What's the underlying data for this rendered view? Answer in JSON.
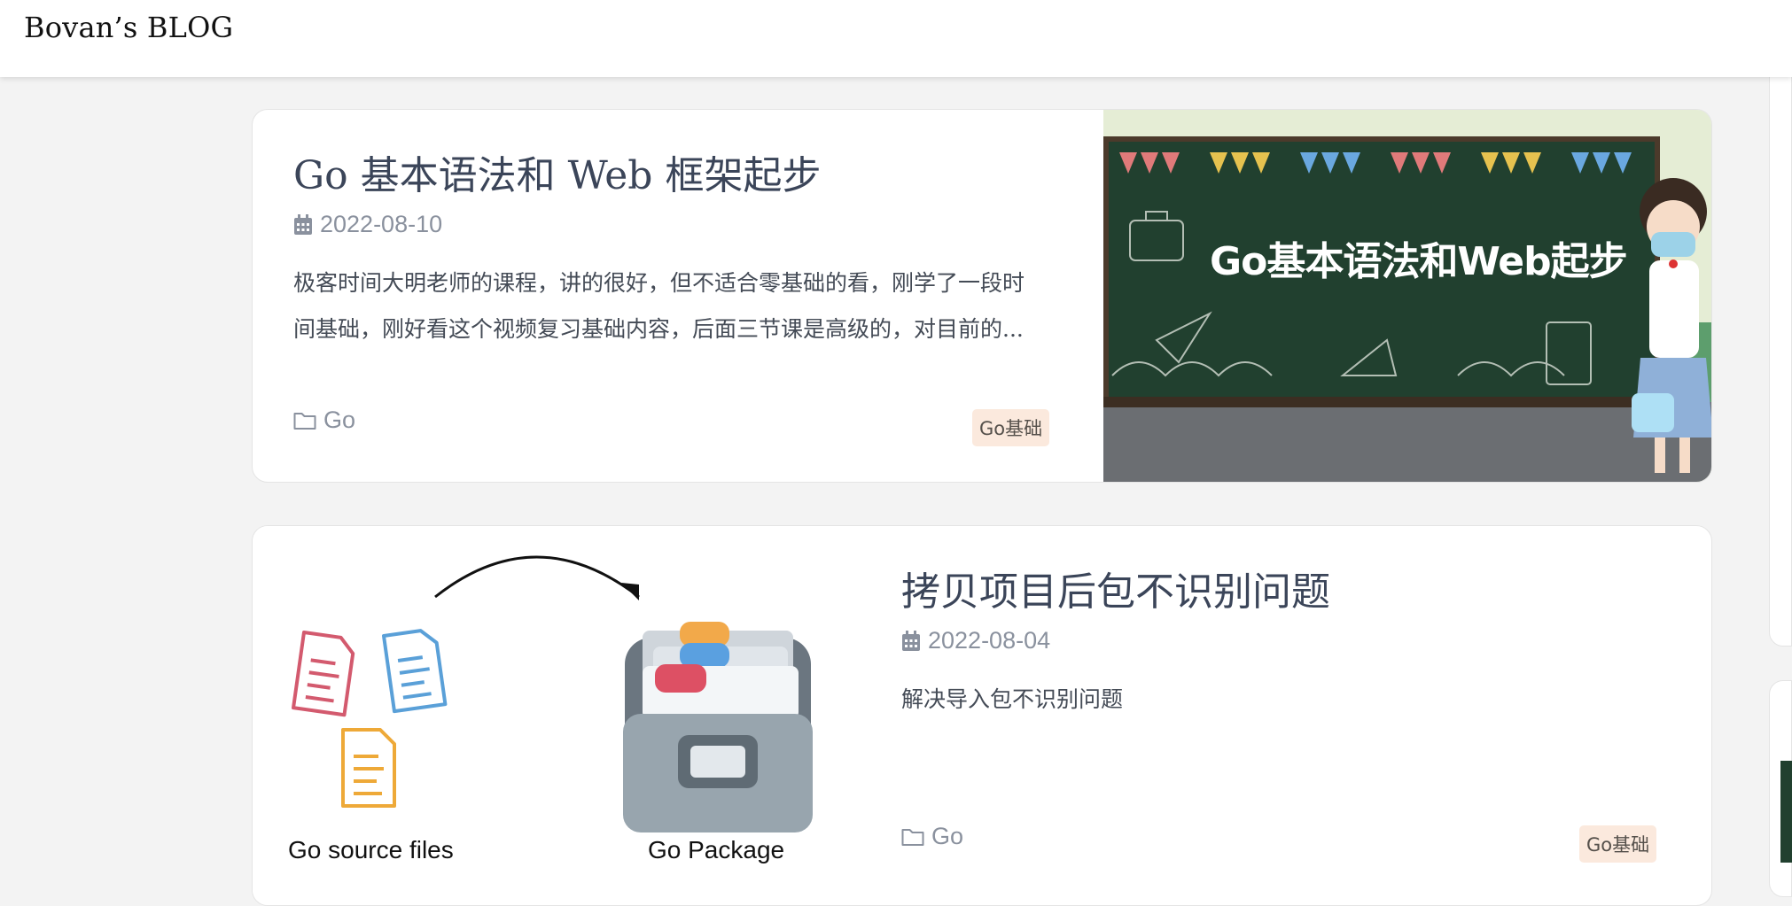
{
  "site": {
    "title": "Bovan’s BLOG"
  },
  "posts": [
    {
      "title": "Go 基本语法和 Web 框架起步",
      "date": "2022-08-10",
      "excerpt_lines": [
        "极客时间大明老师的课程，讲的很好，但不适合零基础的看，刚学了一段时",
        "间基础，刚好看这个视频复习基础内容，后面三节课是高级的，对目前的..."
      ],
      "category": "Go",
      "tag": "Go基础",
      "cover_text": "Go基本语法和Web起步"
    },
    {
      "title": "拷贝项目后包不识别问题",
      "date": "2022-08-04",
      "excerpt_lines": [
        "解决导入包不识别问题"
      ],
      "category": "Go",
      "tag": "Go基础",
      "cover_labels": {
        "left": "Go source files",
        "right": "Go Package"
      }
    }
  ],
  "icons": {
    "date": "calendar-icon",
    "category": "folder-icon"
  },
  "colors": {
    "title": "#3b4559",
    "meta": "#8a919e",
    "tag_bg": "#fbe9dd",
    "chalkboard": "#1f3d2c"
  }
}
